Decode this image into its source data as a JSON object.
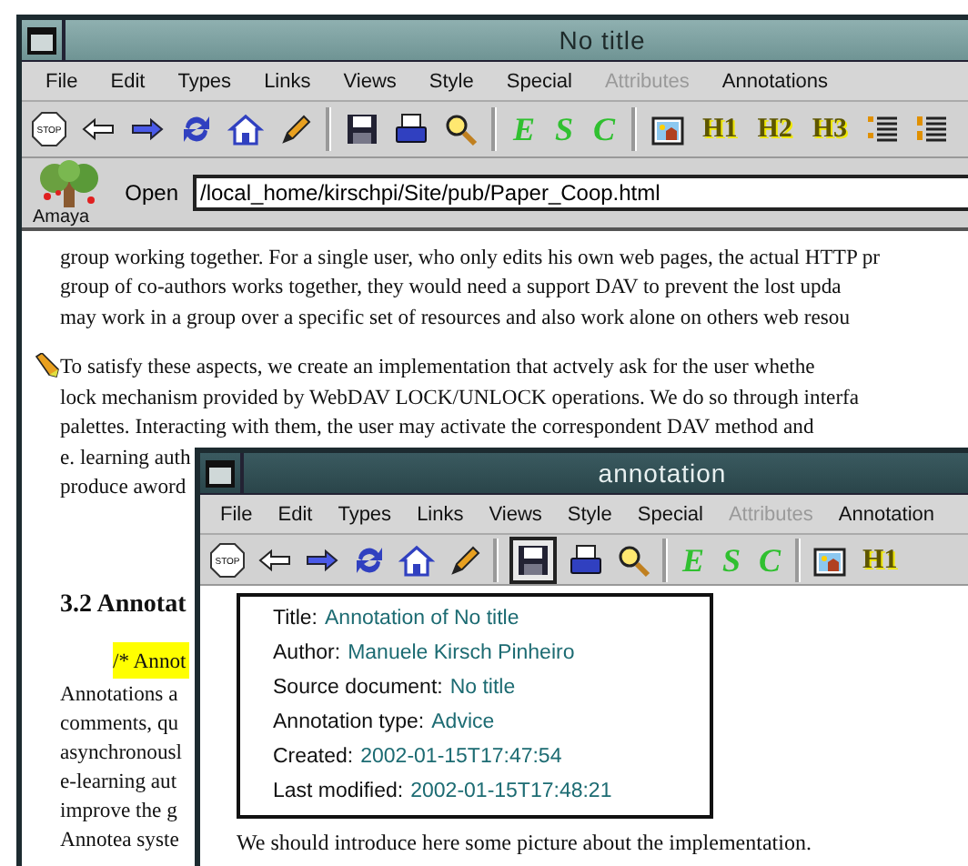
{
  "main_window": {
    "title": "No title",
    "menu": [
      {
        "label": "File",
        "disabled": false
      },
      {
        "label": "Edit",
        "disabled": false
      },
      {
        "label": "Types",
        "disabled": false
      },
      {
        "label": "Links",
        "disabled": false
      },
      {
        "label": "Views",
        "disabled": false
      },
      {
        "label": "Style",
        "disabled": false
      },
      {
        "label": "Special",
        "disabled": false
      },
      {
        "label": "Attributes",
        "disabled": true
      },
      {
        "label": "Annotations",
        "disabled": false
      }
    ],
    "toolbar": [
      {
        "kind": "stop",
        "glyph": "STOP",
        "pressed": false
      },
      {
        "kind": "back",
        "pressed": false
      },
      {
        "kind": "forward",
        "pressed": false
      },
      {
        "kind": "reload",
        "pressed": false
      },
      {
        "kind": "home",
        "pressed": false
      },
      {
        "kind": "edit",
        "pressed": false
      },
      {
        "kind": "sep"
      },
      {
        "kind": "save",
        "pressed": false
      },
      {
        "kind": "print",
        "pressed": false
      },
      {
        "kind": "find",
        "pressed": false
      },
      {
        "kind": "sep"
      },
      {
        "kind": "letter",
        "glyph": "E",
        "pressed": false
      },
      {
        "kind": "letter",
        "glyph": "S",
        "pressed": false
      },
      {
        "kind": "letter",
        "glyph": "C",
        "pressed": false
      },
      {
        "kind": "sep"
      },
      {
        "kind": "image",
        "pressed": false
      },
      {
        "kind": "heading",
        "glyph": "H1",
        "pressed": false
      },
      {
        "kind": "heading",
        "glyph": "H2",
        "pressed": false
      },
      {
        "kind": "heading",
        "glyph": "H3",
        "pressed": false
      },
      {
        "kind": "bullets",
        "pressed": false
      },
      {
        "kind": "numbers",
        "pressed": false
      }
    ],
    "logo_text": "Amaya",
    "open_label": "Open",
    "url": "/local_home/kirschpi/Site/pub/Paper_Coop.html",
    "document": {
      "paragraphs": [
        {
          "annotated": false,
          "lines": [
            "group working together. For a single user, who only edits his own web pages, the actual HTTP pr",
            "group of co-authors works together, they would need a support DAV to prevent the lost upda",
            "may work in a group over a specific set of resources and also work alone on others web resou"
          ]
        },
        {
          "annotated": true,
          "lines": [
            "To satisfy these aspects, we create an implementation that actvely ask for the user whethe",
            "lock mechanism provided by WebDAV LOCK/UNLOCK operations. We do so through interfa",
            "palettes. Interacting with them, the user may activate the correspondent DAV method and",
            "e. learning auth",
            "produce aword"
          ]
        }
      ],
      "heading": "3.2 Annotat",
      "highlight": "/* Annot",
      "lines": [
        "Annotations a",
        "comments, qu",
        "asynchronousl",
        "e-learning aut",
        "improve the g",
        "Annotea syste"
      ]
    }
  },
  "annotation_window": {
    "title": "annotation",
    "menu": [
      {
        "label": "File",
        "disabled": false
      },
      {
        "label": "Edit",
        "disabled": false
      },
      {
        "label": "Types",
        "disabled": false
      },
      {
        "label": "Links",
        "disabled": false
      },
      {
        "label": "Views",
        "disabled": false
      },
      {
        "label": "Style",
        "disabled": false
      },
      {
        "label": "Special",
        "disabled": false
      },
      {
        "label": "Attributes",
        "disabled": true
      },
      {
        "label": "Annotation",
        "disabled": false
      }
    ],
    "toolbar": [
      {
        "kind": "stop",
        "glyph": "STOP",
        "pressed": false
      },
      {
        "kind": "back",
        "pressed": false
      },
      {
        "kind": "forward",
        "pressed": false
      },
      {
        "kind": "reload",
        "pressed": false
      },
      {
        "kind": "home",
        "pressed": false
      },
      {
        "kind": "edit",
        "pressed": false
      },
      {
        "kind": "sep"
      },
      {
        "kind": "save",
        "pressed": true
      },
      {
        "kind": "print",
        "pressed": false
      },
      {
        "kind": "find",
        "pressed": false
      },
      {
        "kind": "sep"
      },
      {
        "kind": "letter",
        "glyph": "E",
        "pressed": false
      },
      {
        "kind": "letter",
        "glyph": "S",
        "pressed": false
      },
      {
        "kind": "letter",
        "glyph": "C",
        "pressed": false
      },
      {
        "kind": "sep"
      },
      {
        "kind": "image",
        "pressed": false
      },
      {
        "kind": "heading",
        "glyph": "H1",
        "pressed": false
      }
    ],
    "metadata": [
      {
        "label": "Title:",
        "value": "Annotation of No title"
      },
      {
        "label": "Author:",
        "value": "Manuele Kirsch Pinheiro"
      },
      {
        "label": "Source document:",
        "value": "No title"
      },
      {
        "label": "Annotation type:",
        "value": "Advice"
      },
      {
        "label": "Created:",
        "value": "2002-01-15T17:47:54"
      },
      {
        "label": "Last modified:",
        "value": "2002-01-15T17:48:21"
      }
    ],
    "body": "We should introduce here some picture about the implementation."
  }
}
